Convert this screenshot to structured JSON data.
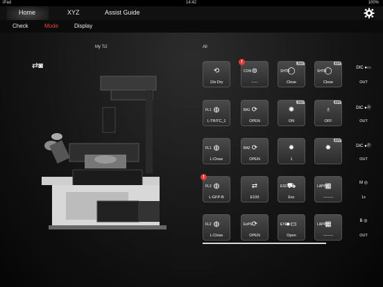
{
  "status": {
    "device": "iPad",
    "time": "14:42",
    "battery": "100%"
  },
  "nav": {
    "tabs": [
      "Home",
      "XYZ",
      "Assist Guide"
    ]
  },
  "subnav": {
    "items": [
      "Check",
      "Mode",
      "Display"
    ]
  },
  "labels": {
    "scope_name": "My Ti2",
    "panel_title": "All"
  },
  "colors": {
    "accent": "#e8473d",
    "alert": "#e53935"
  },
  "tiles": [
    {
      "label": "10x Dry",
      "prefix": "",
      "tag": "",
      "alert": false,
      "icon": "objective-icon"
    },
    {
      "label": "-----",
      "prefix": "CON",
      "tag": "",
      "alert": true,
      "icon": "condenser-icon"
    },
    {
      "label": "Close",
      "prefix": "SHTR",
      "tag": "DIA",
      "alert": false,
      "icon": "shutter-icon"
    },
    {
      "label": "Close",
      "prefix": "SHTR",
      "tag": "EPI",
      "alert": false,
      "icon": "shutter-icon"
    },
    {
      "label": "L:TRITC_1",
      "prefix": "FL1",
      "tag": "",
      "alert": false,
      "icon": "filter-turret-icon"
    },
    {
      "label": "OPEN",
      "prefix": "BA1",
      "tag": "",
      "alert": false,
      "icon": "barrier-icon"
    },
    {
      "label": "ON",
      "prefix": "",
      "tag": "DIA",
      "alert": false,
      "icon": "lamp-icon"
    },
    {
      "label": "OFF",
      "prefix": "",
      "tag": "EPI",
      "alert": false,
      "icon": "epi-lamp-icon"
    },
    {
      "label": "L:Close",
      "prefix": "FL1",
      "tag": "",
      "alert": false,
      "icon": "filter-turret-icon"
    },
    {
      "label": "OPEN",
      "prefix": "BA2",
      "tag": "",
      "alert": false,
      "icon": "barrier-icon"
    },
    {
      "label": "1",
      "prefix": "",
      "tag": "",
      "alert": false,
      "icon": "brightness-icon"
    },
    {
      "label": "",
      "prefix": "",
      "tag": "EPI",
      "alert": false,
      "icon": "brightness-icon"
    },
    {
      "label": "L:GFP-B",
      "prefix": "FL2",
      "tag": "",
      "alert": true,
      "icon": "filter-turret-icon"
    },
    {
      "label": "E100",
      "prefix": "",
      "tag": "",
      "alert": false,
      "icon": "port-icon"
    },
    {
      "label": "Esc",
      "prefix": "ESC",
      "tag": "",
      "alert": false,
      "icon": "escape-icon"
    },
    {
      "label": "--------",
      "prefix": "LAPP1",
      "tag": "",
      "alert": false,
      "icon": "lapp-icon"
    },
    {
      "label": "L:Close",
      "prefix": "FL2",
      "tag": "",
      "alert": false,
      "icon": "filter-turret-icon"
    },
    {
      "label": "OPEN",
      "prefix": "ExPS",
      "tag": "",
      "alert": false,
      "icon": "barrier-icon"
    },
    {
      "label": "Open",
      "prefix": "EYE",
      "tag": "",
      "alert": false,
      "icon": "toggle-icon"
    },
    {
      "label": "--------",
      "prefix": "LAPP2",
      "tag": "",
      "alert": false,
      "icon": "lapp-icon"
    }
  ],
  "side": [
    {
      "prefix": "DIC",
      "label": "OUT",
      "icon": "toggle-icon"
    },
    {
      "prefix": "DIC",
      "label": "OUT",
      "icon": "dic-a-icon"
    },
    {
      "prefix": "DIC",
      "label": "OUT",
      "icon": "dic-p-icon"
    },
    {
      "prefix": "M",
      "label": "1x",
      "icon": "magnifier-icon"
    },
    {
      "prefix": "B",
      "label": "OUT",
      "icon": "bertrand-icon"
    }
  ]
}
